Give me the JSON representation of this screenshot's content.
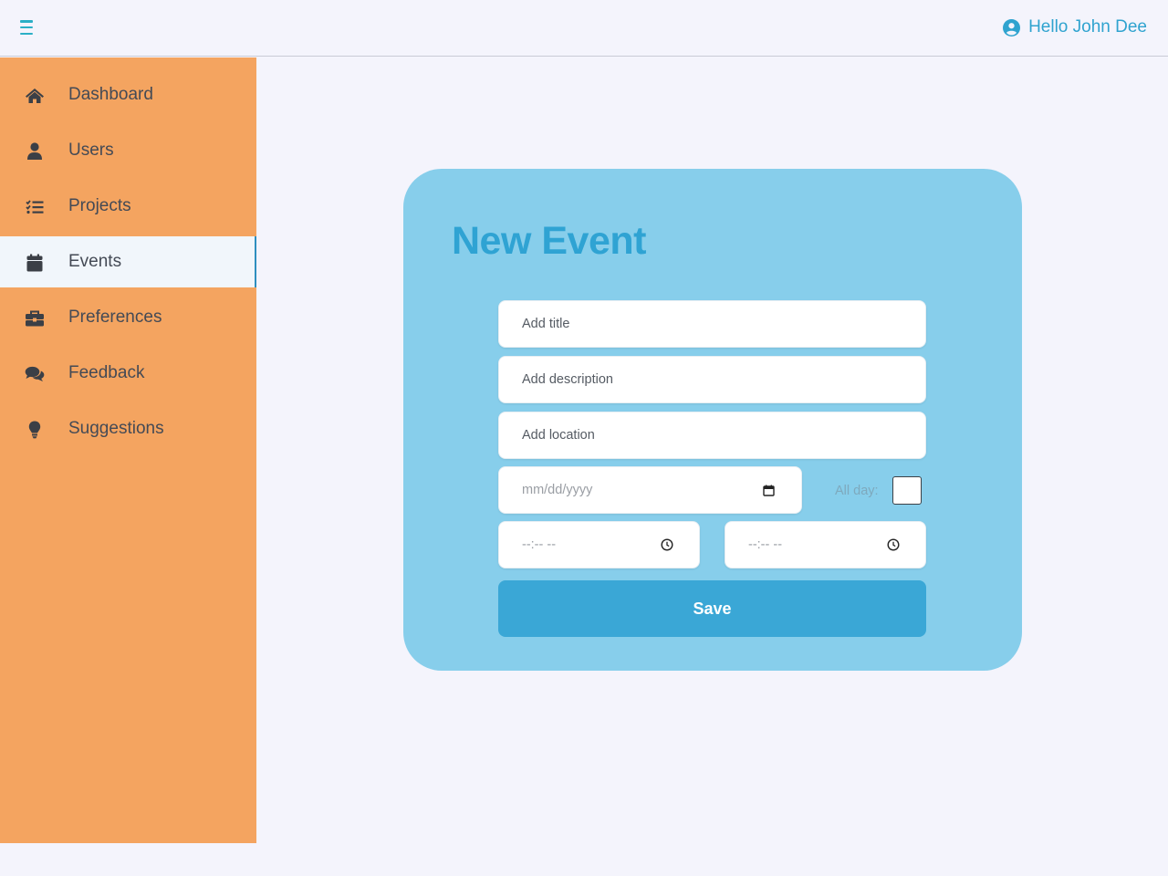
{
  "header": {
    "menu_icon": "hamburger-menu-icon",
    "greeting": "Hello John Dee",
    "user_icon": "user-circle-icon"
  },
  "sidebar": {
    "active": "Events",
    "items": [
      {
        "label": "Dashboard",
        "icon": "home-icon"
      },
      {
        "label": "Users",
        "icon": "user-icon"
      },
      {
        "label": "Projects",
        "icon": "tasks-icon"
      },
      {
        "label": "Events",
        "icon": "calendar-icon"
      },
      {
        "label": "Preferences",
        "icon": "toolbox-icon"
      },
      {
        "label": "Feedback",
        "icon": "comments-icon"
      },
      {
        "label": "Suggestions",
        "icon": "lightbulb-icon"
      }
    ]
  },
  "form": {
    "title": "New Event",
    "title_placeholder": "Add title",
    "description_placeholder": "Add description",
    "location_placeholder": "Add location",
    "date_placeholder": "mm/dd/yyyy",
    "all_day_label": "All day:",
    "all_day_checked": false,
    "start_time_placeholder": "--:-- --",
    "end_time_placeholder": "--:-- --",
    "save_label": "Save"
  },
  "colors": {
    "sidebar": "#f4a460",
    "card": "#87ceeb",
    "accent": "#3aa7d6",
    "active_item": "#f1f6fb",
    "background": "#f4f4fc"
  }
}
